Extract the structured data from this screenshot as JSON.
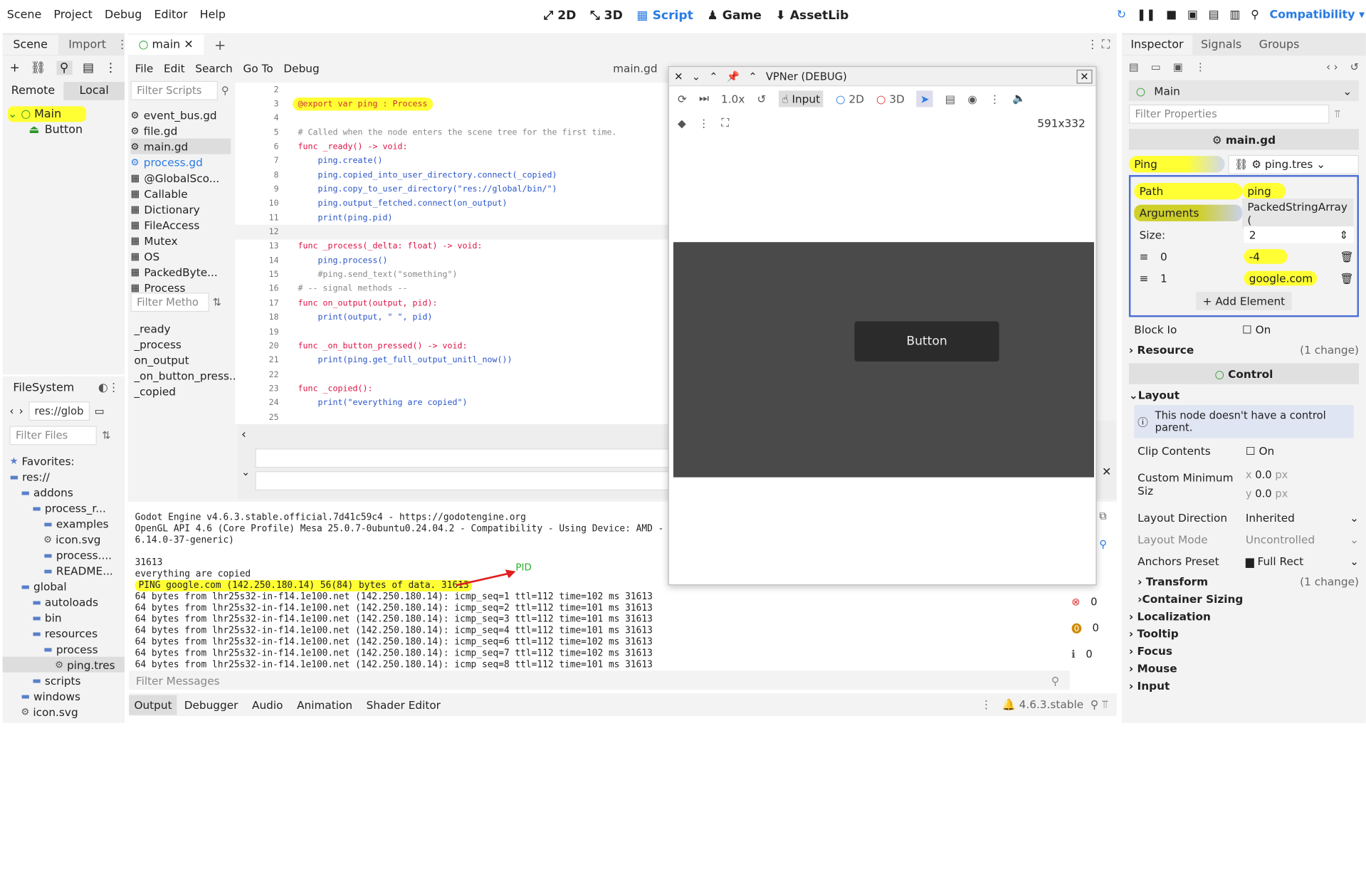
{
  "menu": [
    "Scene",
    "Project",
    "Debug",
    "Editor",
    "Help"
  ],
  "workspaces": [
    {
      "label": "2D",
      "icon": "2d-icon"
    },
    {
      "label": "3D",
      "icon": "3d-icon"
    },
    {
      "label": "Script",
      "icon": "script-icon"
    },
    {
      "label": "Game",
      "icon": "game-icon"
    },
    {
      "label": "AssetLib",
      "icon": "assetlib-icon"
    }
  ],
  "renderer": "Compatibility",
  "left_tabs": [
    "Scene",
    "Import"
  ],
  "remote_label": "Remote",
  "local_label": "Local",
  "scene_tree": [
    {
      "name": "Main",
      "type": "root"
    },
    {
      "name": "Button",
      "type": "child"
    }
  ],
  "script_tab": "main",
  "script_menu": [
    "File",
    "Edit",
    "Search",
    "Go To",
    "Debug"
  ],
  "script_file": "main.gd",
  "filter_scripts_placeholder": "Filter Scripts",
  "scripts": [
    "event_bus.gd",
    "file.gd",
    "main.gd",
    "process.gd",
    "@GlobalSco...",
    "Callable",
    "Dictionary",
    "FileAccess",
    "Mutex",
    "OS",
    "PackedByte...",
    "Process"
  ],
  "filter_methods_placeholder": "Filter Metho",
  "methods": [
    "_ready",
    "_process",
    "on_output",
    "_on_button_press...",
    "_copied"
  ],
  "filesystem_title": "FileSystem",
  "fs_path": "res://glob",
  "filter_files_placeholder": "Filter Files",
  "fs_tree": [
    {
      "label": "Favorites:",
      "depth": 0
    },
    {
      "label": "res://",
      "depth": 0
    },
    {
      "label": "addons",
      "depth": 1
    },
    {
      "label": "process_r...",
      "depth": 2
    },
    {
      "label": "examples",
      "depth": 3
    },
    {
      "label": "icon.svg",
      "depth": 3
    },
    {
      "label": "process....",
      "depth": 3
    },
    {
      "label": "README...",
      "depth": 3
    },
    {
      "label": "global",
      "depth": 1
    },
    {
      "label": "autoloads",
      "depth": 2
    },
    {
      "label": "bin",
      "depth": 2
    },
    {
      "label": "resources",
      "depth": 2
    },
    {
      "label": "process",
      "depth": 3
    },
    {
      "label": "ping.tres",
      "depth": 4
    },
    {
      "label": "scripts",
      "depth": 2
    },
    {
      "label": "windows",
      "depth": 1
    },
    {
      "label": "icon.svg",
      "depth": 1
    }
  ],
  "code_lines": [
    {
      "n": "2",
      "t": ""
    },
    {
      "n": "3",
      "t": "@export var ping : Process"
    },
    {
      "n": "4",
      "t": ""
    },
    {
      "n": "5",
      "t": "# Called when the node enters the scene tree for the first time."
    },
    {
      "n": "6",
      "t": "func _ready() -> void:"
    },
    {
      "n": "7",
      "t": "    ping.create()"
    },
    {
      "n": "8",
      "t": "    ping.copied_into_user_directory.connect(_copied)"
    },
    {
      "n": "9",
      "t": "    ping.copy_to_user_directory(\"res://global/bin/\")"
    },
    {
      "n": "10",
      "t": "    ping.output_fetched.connect(on_output)"
    },
    {
      "n": "11",
      "t": "    print(ping.pid)"
    },
    {
      "n": "12",
      "t": ""
    },
    {
      "n": "13",
      "t": "func _process(_delta: float) -> void:"
    },
    {
      "n": "14",
      "t": "    ping.process()"
    },
    {
      "n": "15",
      "t": "    #ping.send_text(\"something\")"
    },
    {
      "n": "16",
      "t": "# -- signal methods --"
    },
    {
      "n": "17",
      "t": "func on_output(output, pid):"
    },
    {
      "n": "18",
      "t": "    print(output, \" \", pid)"
    },
    {
      "n": "19",
      "t": ""
    },
    {
      "n": "20",
      "t": "func _on_button_pressed() -> void:"
    },
    {
      "n": "21",
      "t": "    print(ping.get_full_output_unitl_now())"
    },
    {
      "n": "22",
      "t": ""
    },
    {
      "n": "23",
      "t": "func _copied():"
    },
    {
      "n": "24",
      "t": "    print(\"everything are copied\")"
    },
    {
      "n": "25",
      "t": ""
    }
  ],
  "output_lines": [
    "Godot Engine v4.6.3.stable.official.7d41c59c4 - https://godotengine.org",
    "OpenGL API 4.6 (Core Profile) Mesa 25.0.7-0ubuntu0.24.04.2 - Compatibility - Using Device: AMD -",
    "6.14.0-37-generic)",
    "",
    "31613",
    "everything are copied",
    "PING google.com (142.250.180.14) 56(84) bytes of data. 31613",
    "64 bytes from lhr25s32-in-f14.1e100.net (142.250.180.14): icmp_seq=1 ttl=112 time=102 ms 31613",
    "64 bytes from lhr25s32-in-f14.1e100.net (142.250.180.14): icmp_seq=2 ttl=112 time=101 ms 31613",
    "64 bytes from lhr25s32-in-f14.1e100.net (142.250.180.14): icmp_seq=3 ttl=112 time=101 ms 31613",
    "64 bytes from lhr25s32-in-f14.1e100.net (142.250.180.14): icmp_seq=4 ttl=112 time=101 ms 31613",
    "64 bytes from lhr25s32-in-f14.1e100.net (142.250.180.14): icmp_seq=6 ttl=112 time=102 ms 31613",
    "64 bytes from lhr25s32-in-f14.1e100.net (142.250.180.14): icmp_seq=7 ttl=112 time=102 ms 31613",
    "64 bytes from lhr25s32-in-f14.1e100.net (142.250.180.14): icmp_seq=8 ttl=112 time=101 ms 31613"
  ],
  "annotation_pid": "PID",
  "counts": {
    "errors": "0",
    "warnings": "0",
    "info": "0"
  },
  "filter_messages_placeholder": "Filter Messages",
  "bottom_tabs": [
    "Output",
    "Debugger",
    "Audio",
    "Animation",
    "Shader Editor"
  ],
  "version": "4.6.3.stable",
  "debug_window": {
    "title": "VPNer (DEBUG)",
    "zoom": "1.0x",
    "input_label": "Input",
    "mode_2d": "2D",
    "mode_3d": "3D",
    "resolution": "591x332",
    "button_label": "Button"
  },
  "inspector": {
    "tabs": [
      "Inspector",
      "Signals",
      "Groups"
    ],
    "node": "Main",
    "filter_placeholder": "Filter Properties",
    "script": "main.gd",
    "ping_label": "Ping",
    "ping_value": "ping.tres",
    "path_label": "Path",
    "path_value": "ping",
    "args_label": "Arguments",
    "args_value": "PackedStringArray (",
    "size_label": "Size:",
    "size_value": "2",
    "items": [
      {
        "index": "0",
        "value": "-4"
      },
      {
        "index": "1",
        "value": "google.com"
      }
    ],
    "add_element": "Add Element",
    "block_io_label": "Block Io",
    "block_io_value": "On",
    "resource_label": "Resource",
    "resource_changes": "(1 change)",
    "control_label": "Control",
    "layout_label": "Layout",
    "warning": "This node doesn't have a control parent.",
    "clip_label": "Clip Contents",
    "clip_value": "On",
    "min_size_label": "Custom Minimum Siz",
    "min_x": "0.0",
    "min_y": "0.0",
    "unit": "px",
    "layout_dir_label": "Layout Direction",
    "layout_dir_value": "Inherited",
    "layout_mode_label": "Layout Mode",
    "layout_mode_value": "Uncontrolled",
    "anchors_label": "Anchors Preset",
    "anchors_value": "Full Rect",
    "transform_label": "Transform",
    "transform_changes": "(1 change)",
    "container_label": "Container Sizing",
    "sections": [
      "Localization",
      "Tooltip",
      "Focus",
      "Mouse",
      "Input"
    ]
  },
  "colors": {
    "accent": "#2a7be4",
    "highlight": "#ffff33",
    "arrow": "#e02020",
    "pid": "#2ab02a"
  }
}
